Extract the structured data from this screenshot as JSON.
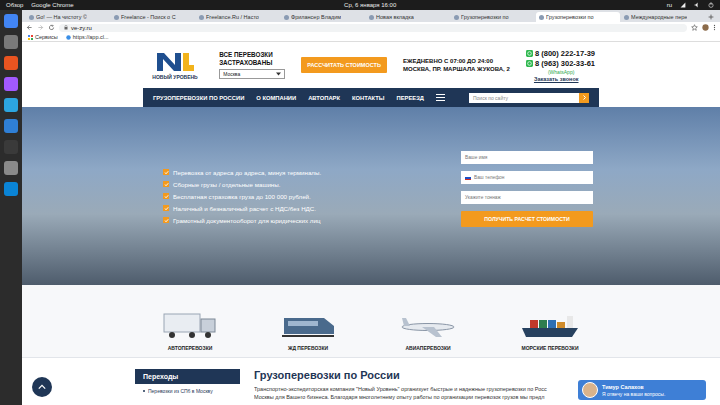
{
  "topbar": {
    "activities": "Обзор",
    "app": "Google Chrome",
    "clock": "Ср, 6 января 16:00",
    "language": "ru"
  },
  "browser": {
    "tabs": [
      {
        "label": "Go! — На чистоту ©",
        "selected": false
      },
      {
        "label": "Freelance - Поиск о С",
        "selected": false
      },
      {
        "label": "Freelance.Ru / Насто",
        "selected": false
      },
      {
        "label": "Фрилансер Владим",
        "selected": false
      },
      {
        "label": "Новая вкладка",
        "selected": false
      },
      {
        "label": "Грузоперевозки по",
        "selected": false
      },
      {
        "label": "Грузоперевозки по",
        "selected": true
      },
      {
        "label": "Международные пере",
        "selected": false
      }
    ],
    "address": "ve-zy.ru",
    "bookmarks": [
      "Сервисы",
      "https://app.cl..."
    ]
  },
  "header": {
    "logo": "НОВЫЙ УРОВЕНЬ",
    "tagline": "ВСЕ ПЕРЕВОЗКИ ЗАСТРАХОВАНЫ",
    "city": "Москва",
    "cta": "РАССЧИТАТЬ СТОИМОСТЬ",
    "hours": "ЕЖЕДНЕВНО С 07:00 ДО 24:00",
    "address": "МОСКВА, ПР. МАРШАЛА ЖУКОВА, 2",
    "phones": [
      "8 (800) 222-17-39",
      "8 (963) 302-33-61"
    ],
    "whatsapp": "(WhatsApp)",
    "callback": "Заказать звонок"
  },
  "nav": {
    "items": [
      "ГРУЗОПЕРЕВОЗКИ ПО РОССИИ",
      "О КОМПАНИИ",
      "АВТОПАРК",
      "КОНТАКТЫ",
      "ПЕРЕЕЗД"
    ],
    "search_placeholder": "Поиск по сайту"
  },
  "hero": {
    "features": [
      "Перевозка от адреса до адреса, минуя терминалы.",
      "Сборные грузы / отдельные машины.",
      "Бесплатная страховка груза до 100 000 рублей.",
      "Наличный и безналичный расчет с НДС/без НДС.",
      "Грамотный документооборот для юридических лиц"
    ],
    "form": {
      "fields": [
        {
          "placeholder": "Ваше имя",
          "kind": "text"
        },
        {
          "placeholder": "Ваш телефон",
          "kind": "phone"
        },
        {
          "placeholder": "Укажите тоннаж",
          "kind": "text"
        }
      ],
      "submit": "ПОЛУЧИТЬ РАСЧЕТ СТОИМОСТИ"
    }
  },
  "services": [
    {
      "label": "АВТОПЕРЕВОЗКИ",
      "kind": "truck"
    },
    {
      "label": "ЖД ПЕРЕВОЗКИ",
      "kind": "train"
    },
    {
      "label": "АВИАПЕРЕВОЗКИ",
      "kind": "plane"
    },
    {
      "label": "МОРСКИЕ ПЕРЕВОЗКИ",
      "kind": "ship"
    }
  ],
  "sidebar": {
    "title": "Переходы",
    "items": [
      "Перевозки из СПб в Москву"
    ]
  },
  "article": {
    "title": "Грузоперевозки по России",
    "lines": [
      "Транспортно-экспедиторская компания \"Новый Уровень\" организует быстрые и надежные грузоперевозки по Росс",
      "Москвы для Вашего бизнеса. Благодаря многолетнему опыту работы по организации перевозок грузов мы предл"
    ]
  },
  "chat": {
    "name": "Тимур Салахов",
    "message": "Я отвечу на ваши вопросы."
  }
}
